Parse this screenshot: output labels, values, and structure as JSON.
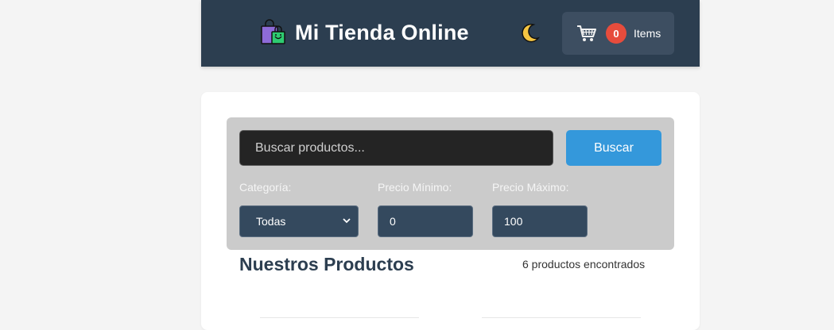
{
  "header": {
    "brand_icon": "shopping-bags-icon",
    "title": "Mi Tienda Online",
    "theme_toggle_icon": "moon-icon",
    "cart": {
      "icon": "shopping-cart-icon",
      "count": "0",
      "label": "Items"
    }
  },
  "search": {
    "placeholder": "Buscar productos...",
    "value": "",
    "button_label": "Buscar"
  },
  "filters": {
    "category_label": "Categoría:",
    "category_value": "Todas",
    "min_price_label": "Precio Mínimo:",
    "min_price_value": "0",
    "max_price_label": "Precio Máximo:",
    "max_price_value": "100"
  },
  "products": {
    "title": "Nuestros Productos",
    "count_text": "6 productos encontrados"
  },
  "colors": {
    "header_bg": "#2c3e50",
    "accent_blue": "#3498db",
    "badge_red": "#e74c3c",
    "control_bg": "#34495e"
  }
}
